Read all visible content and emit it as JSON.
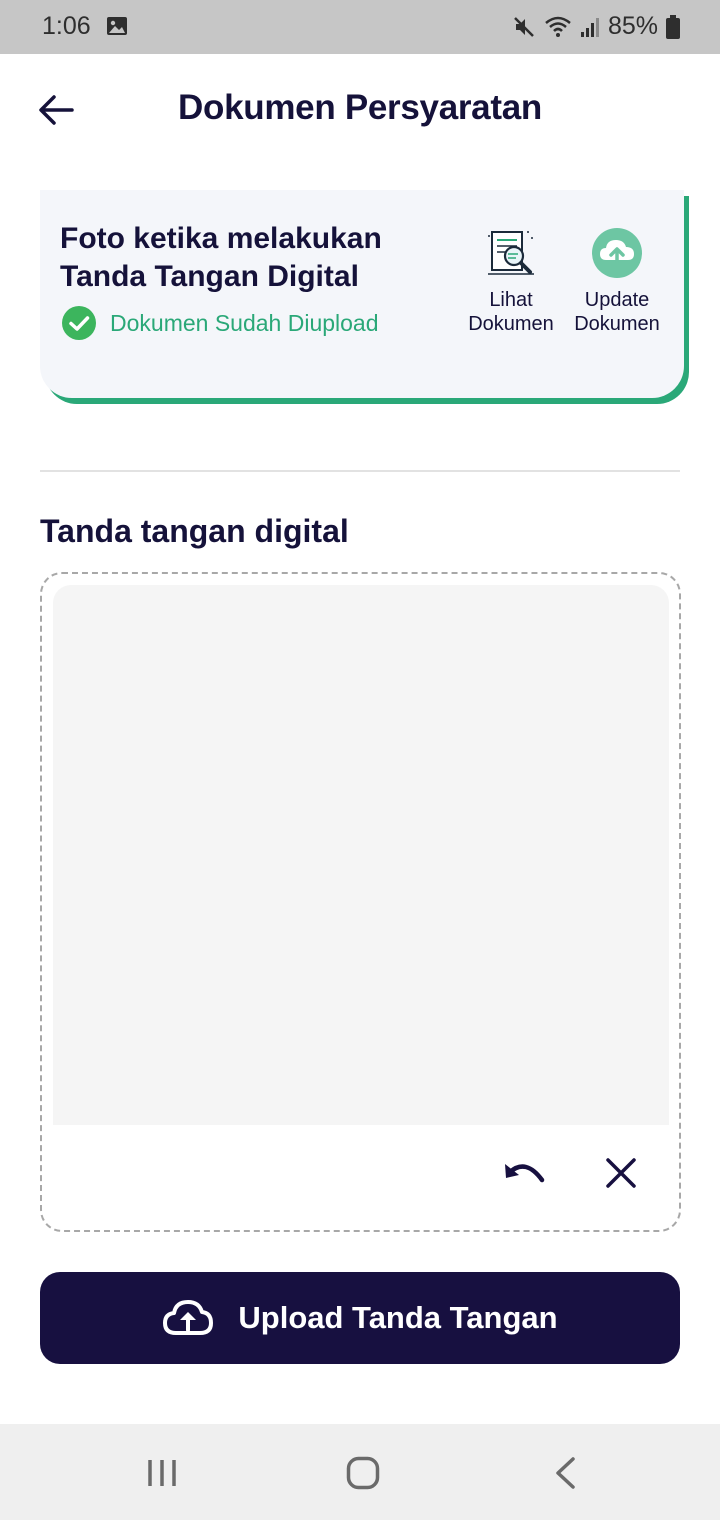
{
  "status_bar": {
    "time": "1:06",
    "battery": "85%",
    "icons": [
      "image-icon",
      "mute-icon",
      "wifi-icon",
      "signal-icon",
      "battery-icon"
    ]
  },
  "header": {
    "title": "Dokumen Persyaratan",
    "back_icon": "arrow-left-icon"
  },
  "document_card": {
    "title": "Foto ketika melakukan Tanda Tangan Digital",
    "status": "Dokumen Sudah Diupload",
    "status_icon": "check-circle-icon",
    "view_action": {
      "label": "Lihat Dokumen",
      "icon": "document-search-icon"
    },
    "update_action": {
      "label": "Update Dokumen",
      "icon": "cloud-upload-icon"
    }
  },
  "signature": {
    "section_title": "Tanda tangan digital",
    "undo_icon": "undo-icon",
    "clear_icon": "close-icon"
  },
  "upload_button": {
    "label": "Upload Tanda Tangan",
    "icon": "cloud-upload-icon"
  },
  "nav_bar": {
    "icons": [
      "recent-apps-icon",
      "home-icon",
      "back-icon"
    ]
  },
  "colors": {
    "primary": "#171040",
    "accent_green": "#2aa878",
    "card_bg": "#f4f6fa",
    "canvas_bg": "#f5f5f5"
  }
}
